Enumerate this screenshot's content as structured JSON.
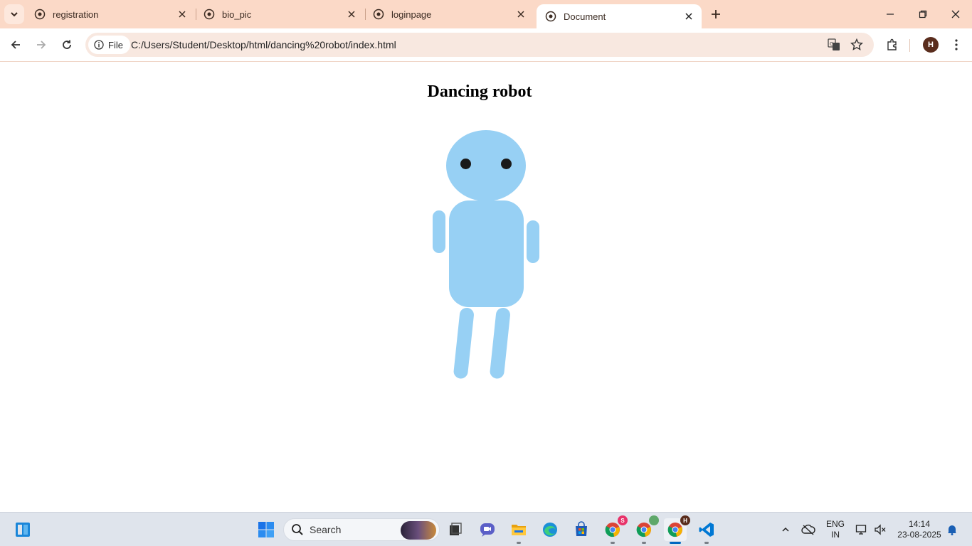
{
  "browser": {
    "tabs": [
      {
        "title": "registration",
        "active": false
      },
      {
        "title": "bio_pic",
        "active": false
      },
      {
        "title": "loginpage",
        "active": false
      },
      {
        "title": "Document",
        "active": true
      }
    ],
    "site_chip_label": "File",
    "url": "C:/Users/Student/Desktop/html/dancing%20robot/index.html",
    "profile_initial": "H",
    "colors": {
      "tabstrip": "#fbd9c7",
      "omnibox": "#f8e8e0",
      "robot": "#97d0f4"
    }
  },
  "page": {
    "heading": "Dancing robot"
  },
  "taskbar": {
    "search_label": "Search",
    "language_line1": "ENG",
    "language_line2": "IN",
    "time": "14:14",
    "date": "23-08-2025",
    "chrome_badge_1": "S",
    "chrome_badge_3": "H",
    "icons": [
      "widgets-icon",
      "windows-start-icon",
      "search-icon",
      "task-view-icon",
      "teams-chat-icon",
      "file-explorer-icon",
      "edge-icon",
      "microsoft-store-icon",
      "chrome-icon",
      "chrome-icon",
      "chrome-icon",
      "vscode-icon"
    ]
  }
}
